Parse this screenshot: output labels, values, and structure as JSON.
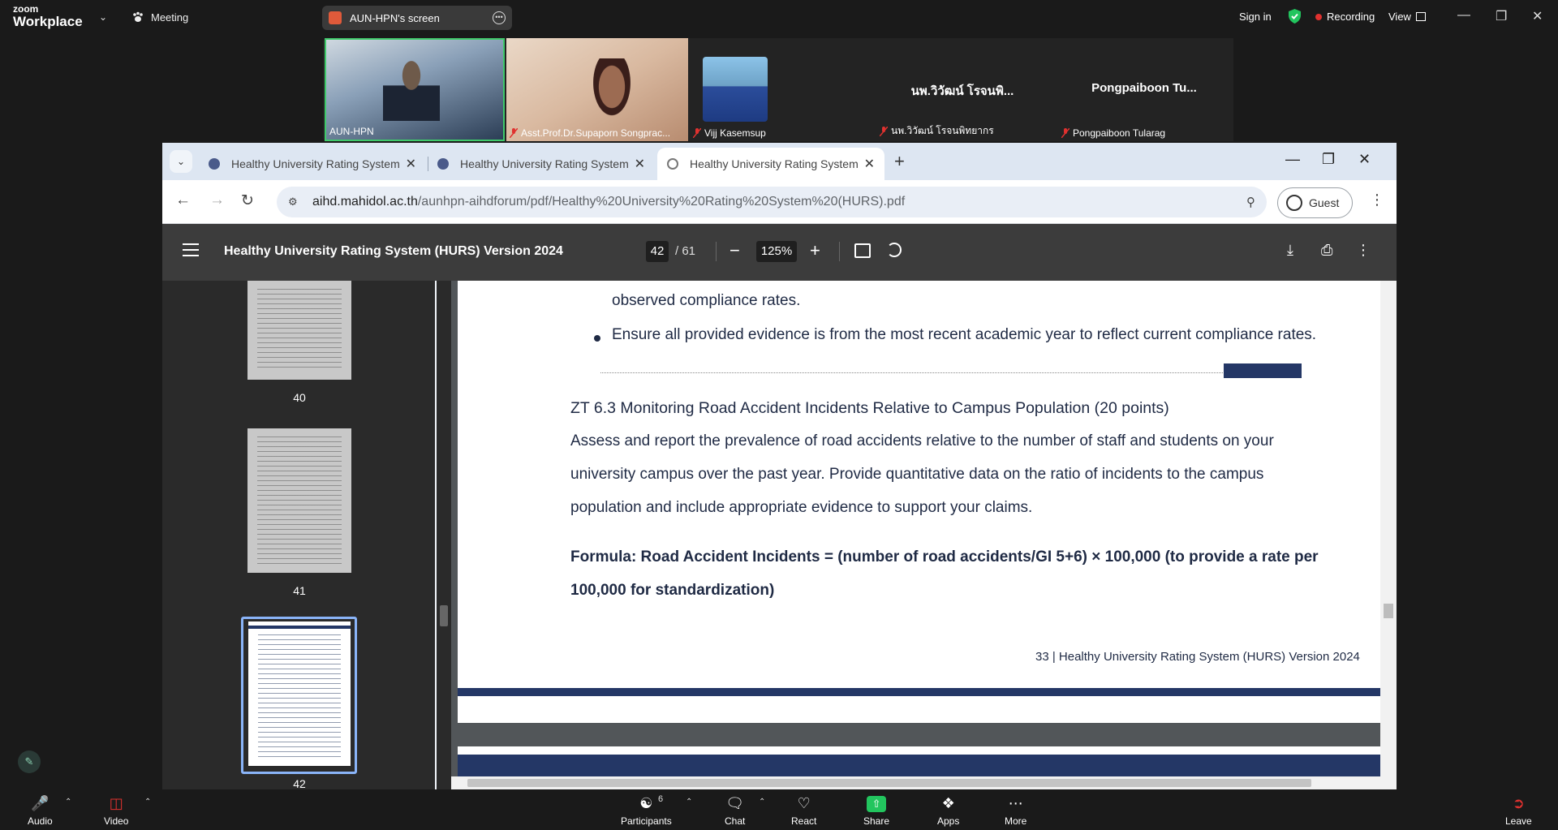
{
  "zoom": {
    "brand_line1": "zoom",
    "brand_line2": "Workplace",
    "meeting_label": "Meeting",
    "screen_share_label": "AUN-HPN's screen",
    "sign_in": "Sign in",
    "recording": "Recording",
    "view": "View",
    "participants": [
      {
        "name": "AUN-HPN"
      },
      {
        "name": "Asst.Prof.Dr.Supaporn Songprac..."
      },
      {
        "name": "Vijj Kasemsup"
      },
      {
        "name": "นพ.วิวัฒน์ โรจนพิทยากร",
        "display": "นพ.วิวัฒน์ โรจนพิ..."
      },
      {
        "name": "Pongpaiboon Tularag",
        "display": "Pongpaiboon  Tu..."
      }
    ],
    "bottom": {
      "audio": "Audio",
      "video": "Video",
      "participants": "Participants",
      "participants_count": "6",
      "chat": "Chat",
      "react": "React",
      "share": "Share",
      "apps": "Apps",
      "more": "More",
      "leave": "Leave"
    }
  },
  "browser": {
    "tabs": [
      {
        "label": "Healthy University Rating System"
      },
      {
        "label": "Healthy University Rating System"
      },
      {
        "label": "Healthy University Rating System"
      }
    ],
    "url_host": "aihd.mahidol.ac.th",
    "url_path": "/aunhpn-aihdforum/pdf/Healthy%20University%20Rating%20System%20(HURS).pdf",
    "guest": "Guest"
  },
  "pdf": {
    "title": "Healthy University Rating System (HURS) Version 2024",
    "page_current": "42",
    "page_total": "/ 61",
    "zoom": "125%",
    "thumbnails": [
      "40",
      "41",
      "42"
    ],
    "content": {
      "line_cont": "observed compliance rates.",
      "bullet": "Ensure all provided evidence is from the most recent academic year to reflect current compliance rates.",
      "heading": "ZT 6.3 Monitoring Road Accident Incidents Relative to Campus Population (20 points)",
      "para1": "Assess and report the prevalence of road accidents relative to the number of staff and students on your",
      "para2": "university campus over the past year. Provide quantitative data on the ratio of incidents to the campus",
      "para3": "population and include appropriate evidence to support your claims.",
      "formula1": "Formula: Road Accident Incidents = (number of road accidents/GI 5+6) × 100,000 (to provide a rate per",
      "formula2": "100,000 for standardization)",
      "footer": "33 | Healthy University Rating System (HURS) Version 2024"
    }
  }
}
